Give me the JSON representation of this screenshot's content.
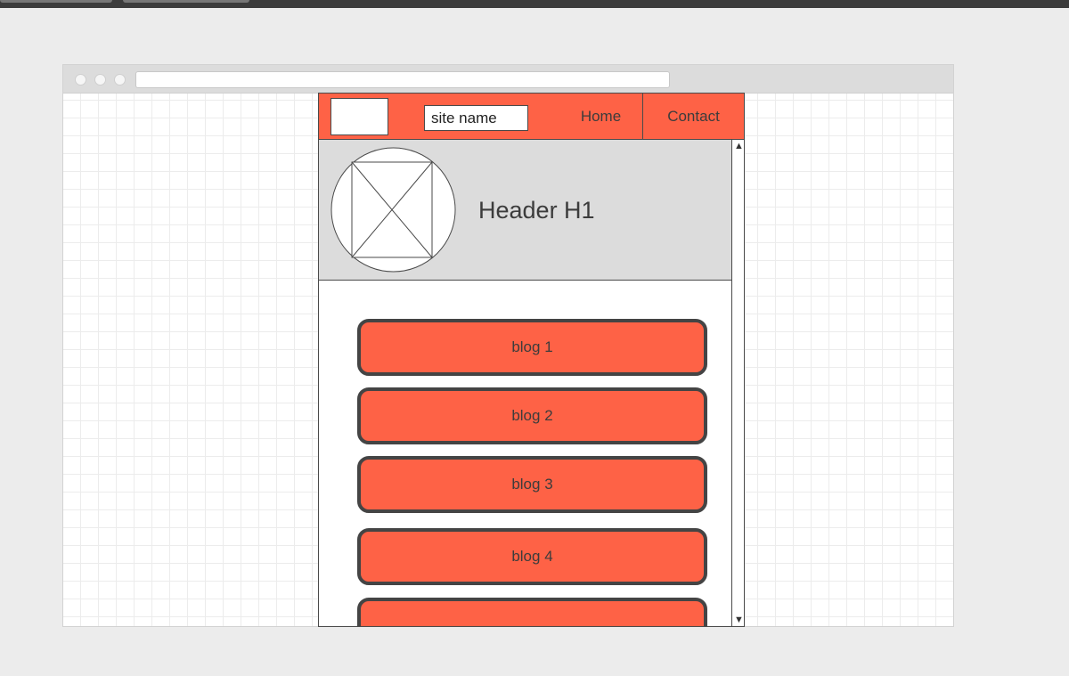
{
  "navbar": {
    "site_name": "site name",
    "links": [
      "Home",
      "Contact"
    ]
  },
  "hero": {
    "title": "Header H1"
  },
  "blog_list": {
    "items": [
      "blog 1",
      "blog 2",
      "blog 3",
      "blog 4",
      ""
    ]
  },
  "colors": {
    "accent": "#fe6246",
    "hero_bg": "#dcdcdc",
    "border": "#4a4a4a"
  },
  "icons": {
    "image_placeholder": "image-placeholder-icon",
    "scroll_up": "scroll-up-arrow-icon",
    "scroll_down": "scroll-down-arrow-icon"
  }
}
